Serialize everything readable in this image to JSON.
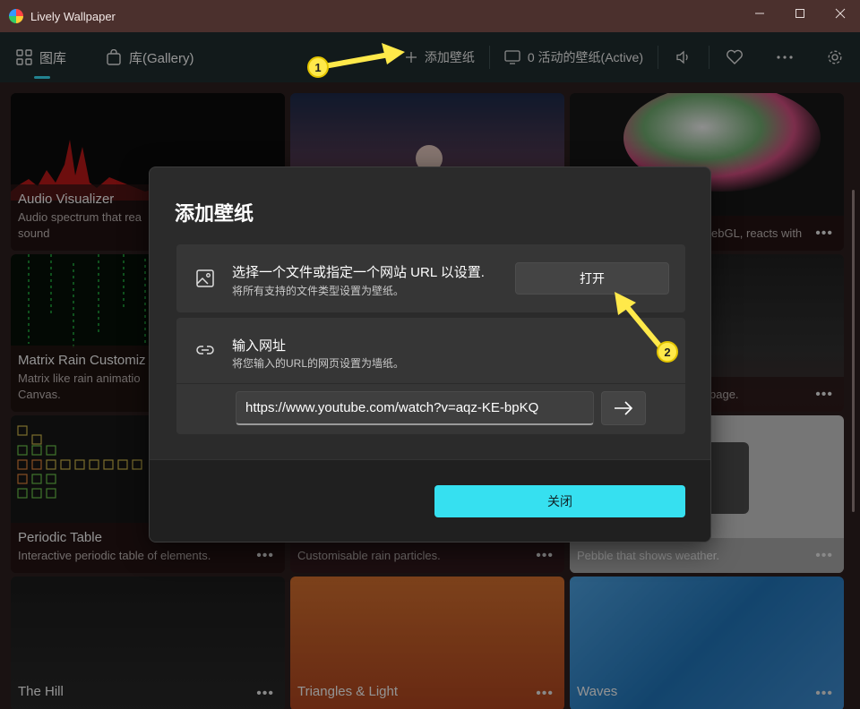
{
  "window": {
    "title": "Lively Wallpaper",
    "controls": [
      "minimize-icon",
      "maximize-icon",
      "close-icon"
    ]
  },
  "nav": {
    "tabs": [
      {
        "label": "图库",
        "icon": "grid-icon",
        "active": true
      },
      {
        "label": "库(Gallery)",
        "icon": "shopping-bag-icon",
        "active": false
      }
    ],
    "add_wallpaper": "添加壁纸",
    "active_wallpapers": "0 活动的壁纸(Active)"
  },
  "gallery": {
    "cards": [
      {
        "title": "Audio Visualizer",
        "desc": "Audio spectrum that rea",
        "desc2": "sound"
      },
      {
        "title": "",
        "desc": "ebGL, reacts with"
      },
      {
        "title": "Matrix Rain Customiz",
        "desc": "Matrix like rain animatio",
        "desc2": "Canvas."
      },
      {
        "title": "",
        "desc": "page."
      },
      {
        "title": "Periodic Table",
        "desc": "Interactive periodic table of elements."
      },
      {
        "title": "",
        "desc": "Customisable rain particles."
      },
      {
        "title": "",
        "desc": "Pebble that shows weather."
      },
      {
        "title": "The Hill",
        "desc": ""
      },
      {
        "title": "Triangles & Light",
        "desc": ""
      },
      {
        "title": "Waves",
        "desc": ""
      }
    ],
    "more": "•••"
  },
  "dialog": {
    "title": "添加壁纸",
    "file_section": {
      "heading": "选择一个文件或指定一个网站 URL 以设置.",
      "sub": "将所有支持的文件类型设置为壁纸。",
      "open_button": "打开"
    },
    "url_section": {
      "heading": "输入网址",
      "sub": "将您输入的URL的网页设置为墙纸。",
      "url_value": "https://www.youtube.com/watch?v=aqz-KE-bpKQ"
    },
    "close_button": "关闭"
  },
  "annotations": {
    "badge1": "1",
    "badge2": "2",
    "color": "#ffe94a"
  },
  "colors": {
    "accent": "#36e0f0",
    "titlebar": "#4b302d",
    "navbar": "#1d2a2c"
  }
}
